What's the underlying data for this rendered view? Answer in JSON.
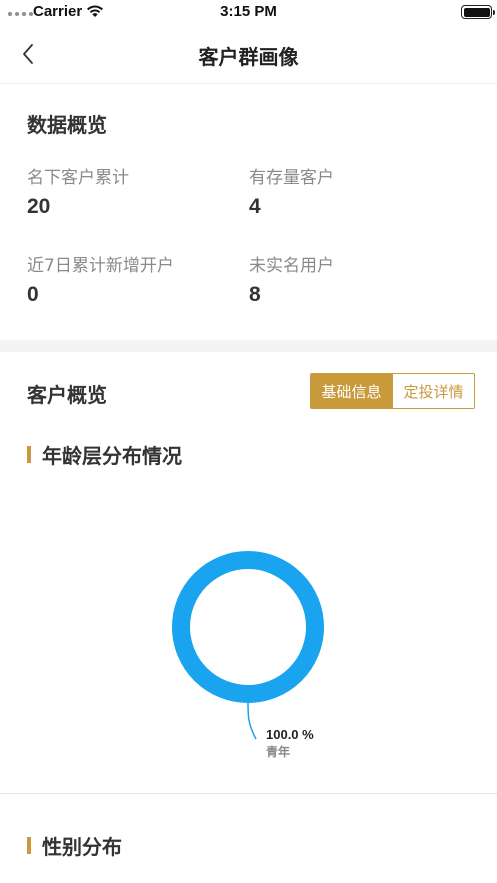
{
  "status_bar": {
    "carrier": "Carrier",
    "time": "3:15 PM"
  },
  "nav": {
    "title": "客户群画像"
  },
  "overview": {
    "title": "数据概览",
    "stats": [
      {
        "label": "名下客户累计",
        "value": "20"
      },
      {
        "label": "有存量客户",
        "value": "4"
      },
      {
        "label": "近7日累计新增开户",
        "value": "0"
      },
      {
        "label": "未实名用户",
        "value": "8"
      }
    ]
  },
  "customer_overview": {
    "title": "客户概览",
    "tabs": [
      {
        "label": "基础信息",
        "active": true
      },
      {
        "label": "定投详情",
        "active": false
      }
    ]
  },
  "age_section": {
    "title": "年龄层分布情况"
  },
  "gender_section": {
    "title": "性别分布"
  },
  "colors": {
    "accent": "#c89a3c",
    "donut": "#1aa3ee"
  },
  "chart_data": {
    "type": "pie",
    "categories": [
      "青年"
    ],
    "values": [
      100.0
    ],
    "value_labels": [
      "100.0 %"
    ]
  }
}
